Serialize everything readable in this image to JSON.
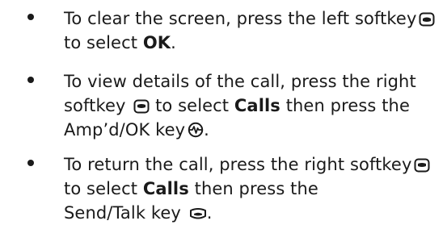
{
  "bullets": [
    {
      "part1": "To clear the screen, press the left softkey",
      "part2": "to select",
      "bold1": "OK",
      "part3": "."
    },
    {
      "part1": "To view details of the call, press the right",
      "part2": "softkey",
      "part3": "to select",
      "bold1": "Calls",
      "part4": "then press the",
      "part5": "Amp’d/OK key",
      "part6": "."
    },
    {
      "part1": "To return the call, press the right softkey",
      "part2": "to select",
      "bold1": "Calls",
      "part3": "then press the",
      "part4": "Send/Talk key",
      "part5": "."
    }
  ],
  "icons": {
    "left_softkey": "left-softkey-icon",
    "right_softkey": "right-softkey-icon",
    "ok_key": "amp-ok-key-icon",
    "send_key": "send-talk-key-icon"
  }
}
